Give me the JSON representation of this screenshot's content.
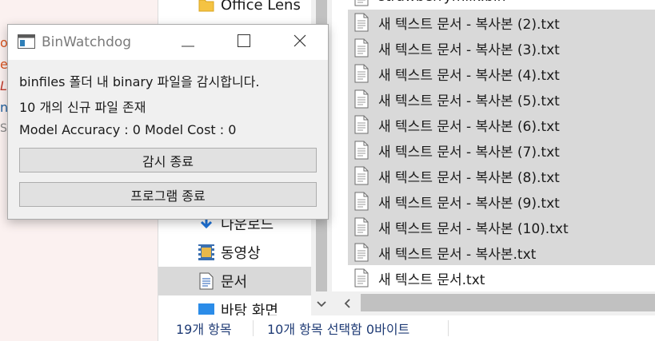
{
  "background_app": {
    "letters": [
      "o",
      "e",
      "L",
      "n",
      "S"
    ],
    "letter_colors": [
      "#d9531e",
      "#d9531e",
      "#c0392b",
      "#1f5f9e",
      "#888888"
    ]
  },
  "explorer": {
    "nav_items": [
      {
        "label": "Office Lens",
        "icon": "folder-icon"
      },
      {
        "label": "다운로드",
        "icon": "download-icon"
      },
      {
        "label": "동영상",
        "icon": "video-icon"
      },
      {
        "label": "문서",
        "icon": "document-icon"
      },
      {
        "label": "바탕 화면",
        "icon": "desktop-icon"
      }
    ],
    "files": [
      {
        "name": "strawberrymilk.bin",
        "selected": false
      },
      {
        "name": "새 텍스트 문서 - 복사본 (2).txt",
        "selected": true
      },
      {
        "name": "새 텍스트 문서 - 복사본 (3).txt",
        "selected": true
      },
      {
        "name": "새 텍스트 문서 - 복사본 (4).txt",
        "selected": true
      },
      {
        "name": "새 텍스트 문서 - 복사본 (5).txt",
        "selected": true
      },
      {
        "name": "새 텍스트 문서 - 복사본 (6).txt",
        "selected": true
      },
      {
        "name": "새 텍스트 문서 - 복사본 (7).txt",
        "selected": true
      },
      {
        "name": "새 텍스트 문서 - 복사본 (8).txt",
        "selected": true
      },
      {
        "name": "새 텍스트 문서 - 복사본 (9).txt",
        "selected": true
      },
      {
        "name": "새 텍스트 문서 - 복사본 (10).txt",
        "selected": true
      },
      {
        "name": "새 텍스트 문서 - 복사본.txt",
        "selected": true
      },
      {
        "name": "새 텍스트 문서.txt",
        "selected": false
      }
    ],
    "status": {
      "item_count": "19개 항목",
      "selection": "10개 항목 선택함 0바이트"
    }
  },
  "dialog": {
    "title": "BinWatchdog",
    "message": "binfiles 폴더 내 binary 파일을 감시합니다.",
    "new_files": "10 개의 신규 파일 존재",
    "model_stats": "Model Accuracy : 0 Model Cost : 0",
    "stop_watch_label": "감시 종료",
    "exit_label": "프로그램 종료"
  },
  "colors": {
    "selection": "#d9d9d9",
    "status_text": "#1f3b75",
    "dialog_bg": "#f0f0f0"
  }
}
